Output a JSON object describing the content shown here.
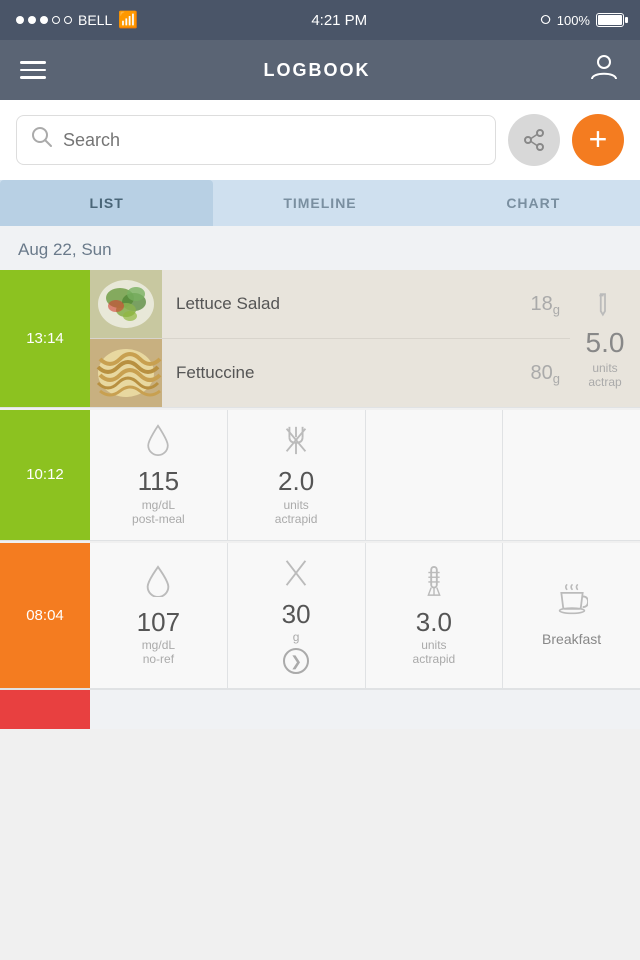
{
  "statusBar": {
    "carrier": "BELL",
    "time": "4:21 PM",
    "battery": "100%"
  },
  "header": {
    "title": "LOGBOOK",
    "menuLabel": "menu",
    "userLabel": "user"
  },
  "search": {
    "placeholder": "Search",
    "shareLabel": "share",
    "addLabel": "add"
  },
  "tabs": [
    {
      "id": "list",
      "label": "LIST",
      "active": true
    },
    {
      "id": "timeline",
      "label": "TIMELINE",
      "active": false
    },
    {
      "id": "chart",
      "label": "CHART",
      "active": false
    }
  ],
  "dateHeader": "Aug 22, Sun",
  "entries": [
    {
      "time": "13:14",
      "timeColor": "green",
      "foods": [
        {
          "name": "Lettuce Salad",
          "amount": "18",
          "unit": "g"
        },
        {
          "name": "Fettuccine",
          "amount": "80",
          "unit": "g"
        }
      ],
      "sideValue": "5.0",
      "sideUnit": "units",
      "sideLabel": "actrap"
    },
    {
      "time": "10:12",
      "timeColor": "green",
      "metrics": [
        {
          "type": "drop",
          "value": "115",
          "unit": "mg/dL",
          "label": "post-meal"
        },
        {
          "type": "fork",
          "value": "2.0",
          "unit": "units",
          "label": "actrapid"
        }
      ]
    },
    {
      "time": "08:04",
      "timeColor": "orange",
      "metrics": [
        {
          "type": "drop",
          "value": "107",
          "unit": "mg/dL",
          "label": "no-ref"
        },
        {
          "type": "fork",
          "value": "30",
          "unit": "g",
          "label": "",
          "hasArrow": true
        },
        {
          "type": "tube",
          "value": "3.0",
          "unit": "units",
          "label": "actrapid"
        },
        {
          "type": "coffee",
          "value": "",
          "unit": "",
          "label": "Breakfast"
        }
      ]
    }
  ]
}
